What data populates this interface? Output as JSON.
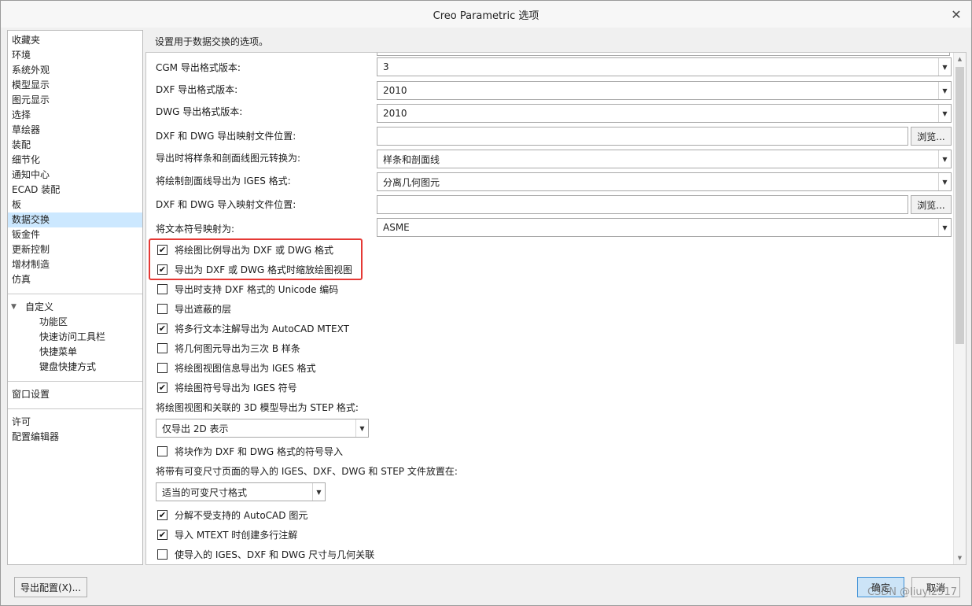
{
  "window": {
    "title": "Creo Parametric 选项"
  },
  "nav": {
    "items": [
      "收藏夹",
      "环境",
      "系统外观",
      "模型显示",
      "图元显示",
      "选择",
      "草绘器",
      "装配",
      "细节化",
      "通知中心",
      "ECAD 装配",
      "板",
      "数据交换",
      "钣金件",
      "更新控制",
      "增材制造",
      "仿真"
    ],
    "selected": "数据交换",
    "customize": {
      "label": "自定义",
      "children": [
        "功能区",
        "快速访问工具栏",
        "快捷菜单",
        "键盘快捷方式"
      ]
    },
    "window_settings": "窗口设置",
    "bottom_items": [
      "许可",
      "配置编辑器"
    ]
  },
  "main": {
    "header": "设置用于数据交换的选项。",
    "fields": [
      {
        "label": "CGM 导出格式版本:",
        "value": "3",
        "kind": "combo"
      },
      {
        "label": "DXF 导出格式版本:",
        "value": "2010",
        "kind": "combo"
      },
      {
        "label": "DWG 导出格式版本:",
        "value": "2010",
        "kind": "combo"
      },
      {
        "label": "DXF 和 DWG 导出映射文件位置:",
        "value": "",
        "kind": "file"
      },
      {
        "label": "导出时将样条和剖面线图元转换为:",
        "value": "样条和剖面线",
        "kind": "combo"
      },
      {
        "label": "将绘制剖面线导出为 IGES 格式:",
        "value": "分离几何图元",
        "kind": "combo"
      },
      {
        "label": "DXF 和 DWG 导入映射文件位置:",
        "value": "",
        "kind": "file"
      },
      {
        "label": "将文本符号映射为:",
        "value": "ASME",
        "kind": "combo"
      }
    ],
    "browse_label": "浏览...",
    "checkboxes_a": [
      {
        "label": "将绘图比例导出为 DXF 或 DWG 格式",
        "checked": true
      },
      {
        "label": "导出为 DXF 或 DWG 格式时缩放绘图视图",
        "checked": true
      },
      {
        "label": "导出时支持 DXF 格式的 Unicode 编码",
        "checked": false
      },
      {
        "label": "导出遮蔽的层",
        "checked": false
      },
      {
        "label": "将多行文本注解导出为 AutoCAD MTEXT",
        "checked": true
      },
      {
        "label": "将几何图元导出为三次 B 样条",
        "checked": false
      },
      {
        "label": "将绘图视图信息导出为 IGES 格式",
        "checked": false
      },
      {
        "label": "将绘图符号导出为 IGES 符号",
        "checked": true
      }
    ],
    "step_label": "将绘图视图和关联的 3D 模型导出为 STEP 格式:",
    "step_value": "仅导出 2D 表示",
    "checkbox_block_import": {
      "label": "将块作为 DXF 和 DWG 格式的符号导入",
      "checked": false
    },
    "place_label": "将带有可变尺寸页面的导入的 IGES、DXF、DWG 和 STEP 文件放置在:",
    "place_value": "适当的可变尺寸格式",
    "checkboxes_b": [
      {
        "label": "分解不受支持的 AutoCAD 图元",
        "checked": true
      },
      {
        "label": "导入 MTEXT 时创建多行注解",
        "checked": true
      },
      {
        "label": "使导入的 IGES、DXF 和 DWG 尺寸与几何关联",
        "checked": false
      }
    ]
  },
  "footer": {
    "export_config": "导出配置(X)...",
    "ok": "确定",
    "cancel": "取消",
    "watermark": "CSDN @liuyl2517"
  },
  "colors": {
    "selection": "#cce8ff",
    "highlight_box": "#e53935",
    "primary_button": "#cce4f7"
  }
}
